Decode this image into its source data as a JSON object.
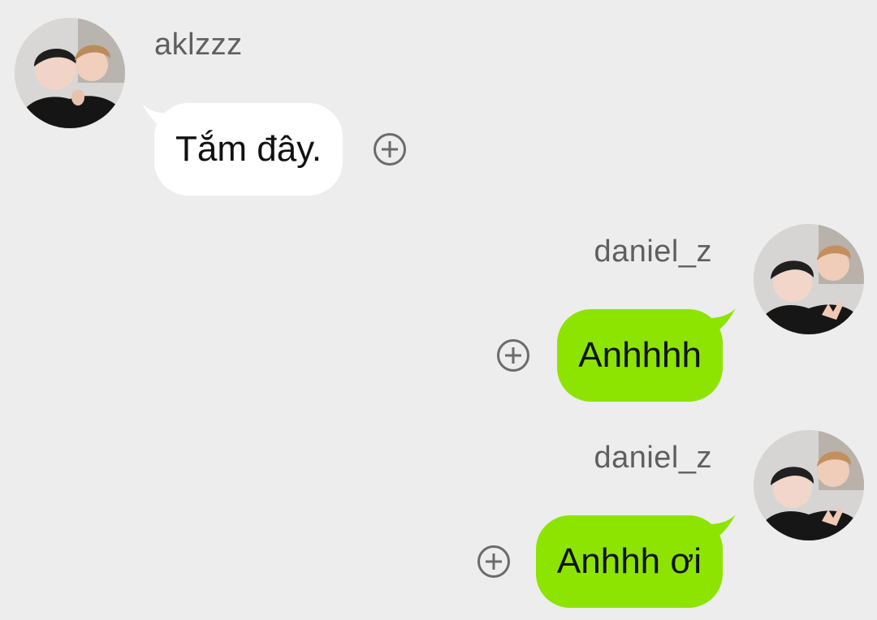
{
  "messages": [
    {
      "direction": "incoming",
      "username": "aklzzz",
      "text": "Tắm đây."
    },
    {
      "direction": "outgoing",
      "username": "daniel_z",
      "text": "Anhhhh"
    },
    {
      "direction": "outgoing",
      "username": "daniel_z",
      "text": "Anhhh ơi"
    }
  ],
  "colors": {
    "background": "#ededed",
    "incoming_bubble": "#ffffff",
    "outgoing_bubble": "#8de400",
    "username_text": "#5f5f5f"
  },
  "icons": {
    "add_reaction": "add-reaction-icon",
    "avatar": "avatar-photo"
  }
}
